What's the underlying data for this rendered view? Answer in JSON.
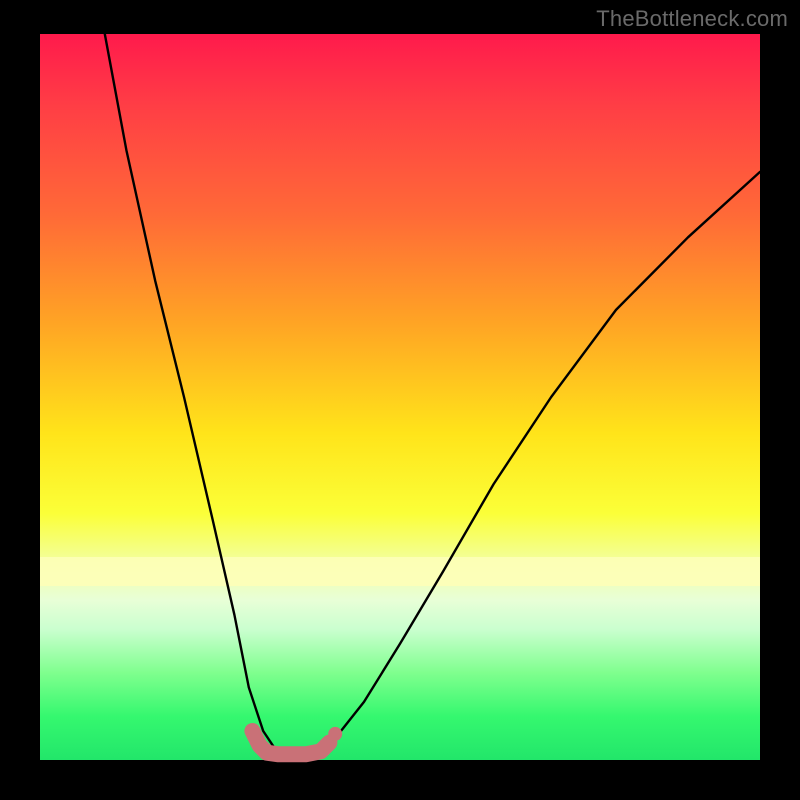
{
  "branding": {
    "text": "TheBottleneck.com"
  },
  "colors": {
    "curve": "#000000",
    "marker": "#c97177",
    "frame": "#000000"
  },
  "chart_data": {
    "type": "line",
    "title": "",
    "xlabel": "",
    "ylabel": "",
    "xlim": [
      0,
      100
    ],
    "ylim": [
      0,
      100
    ],
    "grid": false,
    "legend": false,
    "note": "Axes carry no labels or ticks in the source image; values are normalized 0–100 from pixel position. Lower y means closer to the bottom green band (the minimum).",
    "series": [
      {
        "name": "bottleneck-curve",
        "x": [
          9,
          12,
          16,
          20,
          24,
          27,
          29,
          31,
          33,
          35,
          39,
          41,
          45,
          50,
          56,
          63,
          71,
          80,
          90,
          100
        ],
        "y": [
          100,
          84,
          66,
          50,
          33,
          20,
          10,
          4,
          1,
          1,
          1,
          3,
          8,
          16,
          26,
          38,
          50,
          62,
          72,
          81
        ]
      }
    ],
    "markers": {
      "name": "valley-highlight",
      "x": [
        29.5,
        30.5,
        31.5,
        33.0,
        35.0,
        37.0,
        39.0,
        40.2,
        41.0
      ],
      "y": [
        4.0,
        2.0,
        1.0,
        0.8,
        0.8,
        0.8,
        1.2,
        2.4,
        3.6
      ]
    }
  }
}
